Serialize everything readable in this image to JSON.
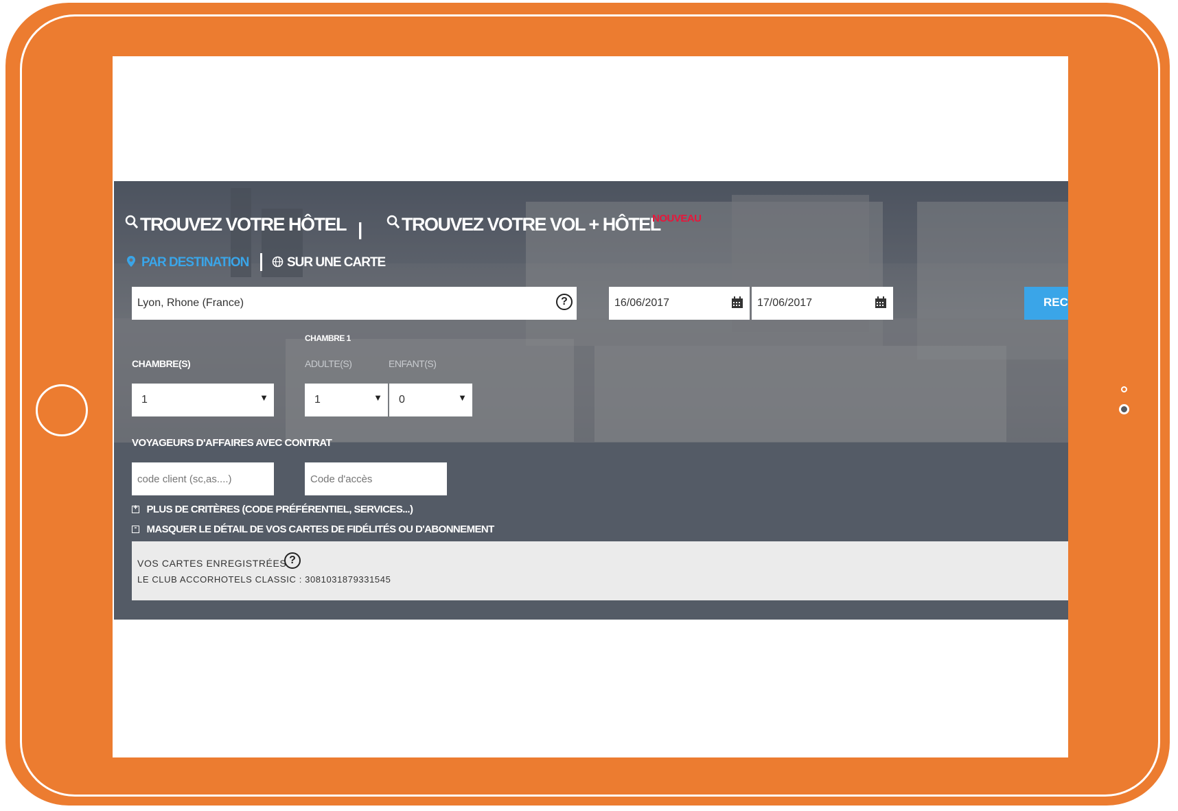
{
  "search": {
    "tab_hotel": "TROUVEZ VOTRE HÔTEL",
    "separator": "|",
    "tab_flight_hotel": "TROUVEZ VOTRE VOL + HÔTEL",
    "new_badge": "NOUVEAU",
    "subtab_destination": "PAR DESTINATION",
    "subtab_map": "SUR UNE CARTE",
    "destination_value": "Lyon, Rhone (France)",
    "checkin_value": "16/06/2017",
    "checkout_value": "17/06/2017",
    "search_button": "REC"
  },
  "rooms": {
    "room_group_label": "CHAMBRE 1",
    "rooms_label": "CHAMBRE(S)",
    "adults_label": "ADULTE(S)",
    "children_label": "ENFANT(S)",
    "rooms_value": "1",
    "adults_value": "1",
    "children_value": "0"
  },
  "business": {
    "label": "VOYAGEURS D'AFFAIRES AVEC CONTRAT",
    "client_code_placeholder": "code client (sc,as....)",
    "access_code_placeholder": "Code d'accès"
  },
  "criteria": {
    "more_label": "PLUS DE CRITÈRES (CODE PRÉFÉRENTIEL, SERVICES...)",
    "more_sign": "+",
    "hide_label": "MASQUER LE DÉTAIL DE VOS CARTES DE FIDÉLITÉS OU D'ABONNEMENT",
    "hide_sign": "-"
  },
  "cards": {
    "title": "VOS CARTES ENREGISTRÉES",
    "help": "?",
    "card_line": "LE CLUB ACCORHOTELS CLASSIC : 3081031879331545"
  },
  "colors": {
    "tablet_frame": "#ec7c30",
    "accent_blue": "#3aa5e8",
    "new_badge": "#e8163a",
    "panel": "#545b66"
  },
  "icons": {
    "search": "search-icon",
    "location": "location-pin-icon",
    "globe": "globe-icon",
    "calendar": "calendar-icon",
    "help": "help-circle-icon"
  }
}
